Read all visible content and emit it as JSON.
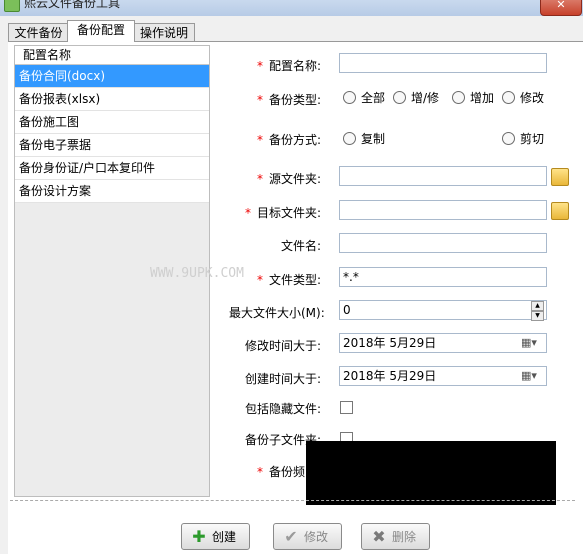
{
  "window": {
    "title": "熙云文件备份工具",
    "close_label": "✕"
  },
  "tabs": [
    {
      "label": "文件备份"
    },
    {
      "label": "备份配置"
    },
    {
      "label": "操作说明"
    }
  ],
  "config_list": {
    "header": "配置名称",
    "items": [
      "备份合同(docx)",
      "备份报表(xlsx)",
      "备份施工图",
      "备份电子票据",
      "备份身份证/户口本复印件",
      "备份设计方案"
    ],
    "selected_index": 0
  },
  "form": {
    "required_mark": "*",
    "name_label": "配置名称:",
    "name_value": "",
    "backup_type_label": "备份类型:",
    "backup_type_options": [
      "全部",
      "增/修",
      "增加",
      "修改"
    ],
    "backup_mode_label": "备份方式:",
    "backup_mode_options": [
      "复制",
      "剪切"
    ],
    "source_label": "源文件夹:",
    "source_value": "",
    "target_label": "目标文件夹:",
    "target_value": "",
    "filename_label": "文件名:",
    "filename_value": "",
    "filetype_label": "文件类型:",
    "filetype_value": "*.*",
    "maxsize_label": "最大文件大小(M):",
    "maxsize_value": "0",
    "modified_label": "修改时间大于:",
    "modified_value": "2018年  5月29日",
    "created_label": "创建时间大于:",
    "created_value": "2018年  5月29日",
    "hidden_label": "包括隐藏文件:",
    "subfolder_label": "备份子文件夹:",
    "frequency_label": "备份频"
  },
  "watermark": "WWW.9UPK.COM",
  "buttons": {
    "create": "创建",
    "modify": "修改",
    "delete": "删除"
  },
  "icons": {
    "create": "plus-icon",
    "modify": "check-icon",
    "delete": "x-icon",
    "folder": "folder-icon",
    "calendar": "calendar-icon"
  },
  "colors": {
    "selection": "#3399ff",
    "required": "#e00000"
  }
}
